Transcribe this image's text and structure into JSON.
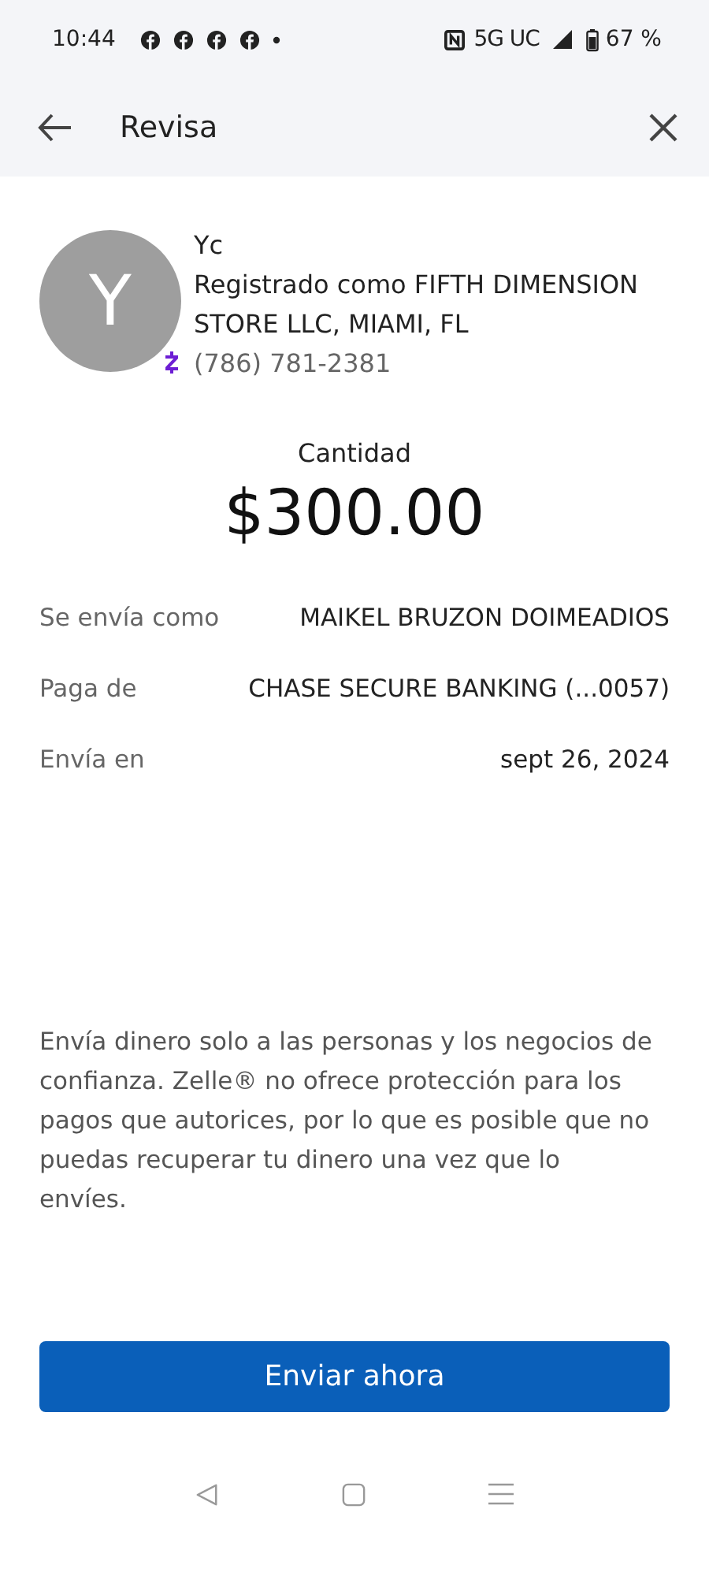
{
  "status_bar": {
    "time": "10:44",
    "notification_icons": [
      {
        "kind": "app"
      },
      {
        "kind": "app"
      },
      {
        "kind": "app"
      },
      {
        "kind": "app"
      },
      {
        "kind": "more"
      }
    ],
    "network": "5G UC",
    "battery": "67 %"
  },
  "header": {
    "title": "Revisa"
  },
  "recipient": {
    "avatar_letter": "Y",
    "name": "Yc",
    "registered_as": "Registrado como FIFTH DIMENSION STORE LLC, MIAMI, FL",
    "phone": "(786) 781-2381"
  },
  "amount": {
    "label": "Cantidad",
    "value": "$300.00"
  },
  "details": [
    {
      "label": "Se envía como",
      "value": "MAIKEL BRUZON DOIMEADIOS"
    },
    {
      "label": "Paga de",
      "value": "CHASE SECURE BANKING (...0057)"
    },
    {
      "label": "Envía en",
      "value": "sept 26, 2024"
    }
  ],
  "disclaimer": "Envía dinero solo a las personas y los negocios de confianza. Zelle® no ofrece protección para los pagos que autorices, por lo que es posible que no puedas recuperar tu dinero una vez que lo envíes.",
  "send_button": "Enviar ahora"
}
